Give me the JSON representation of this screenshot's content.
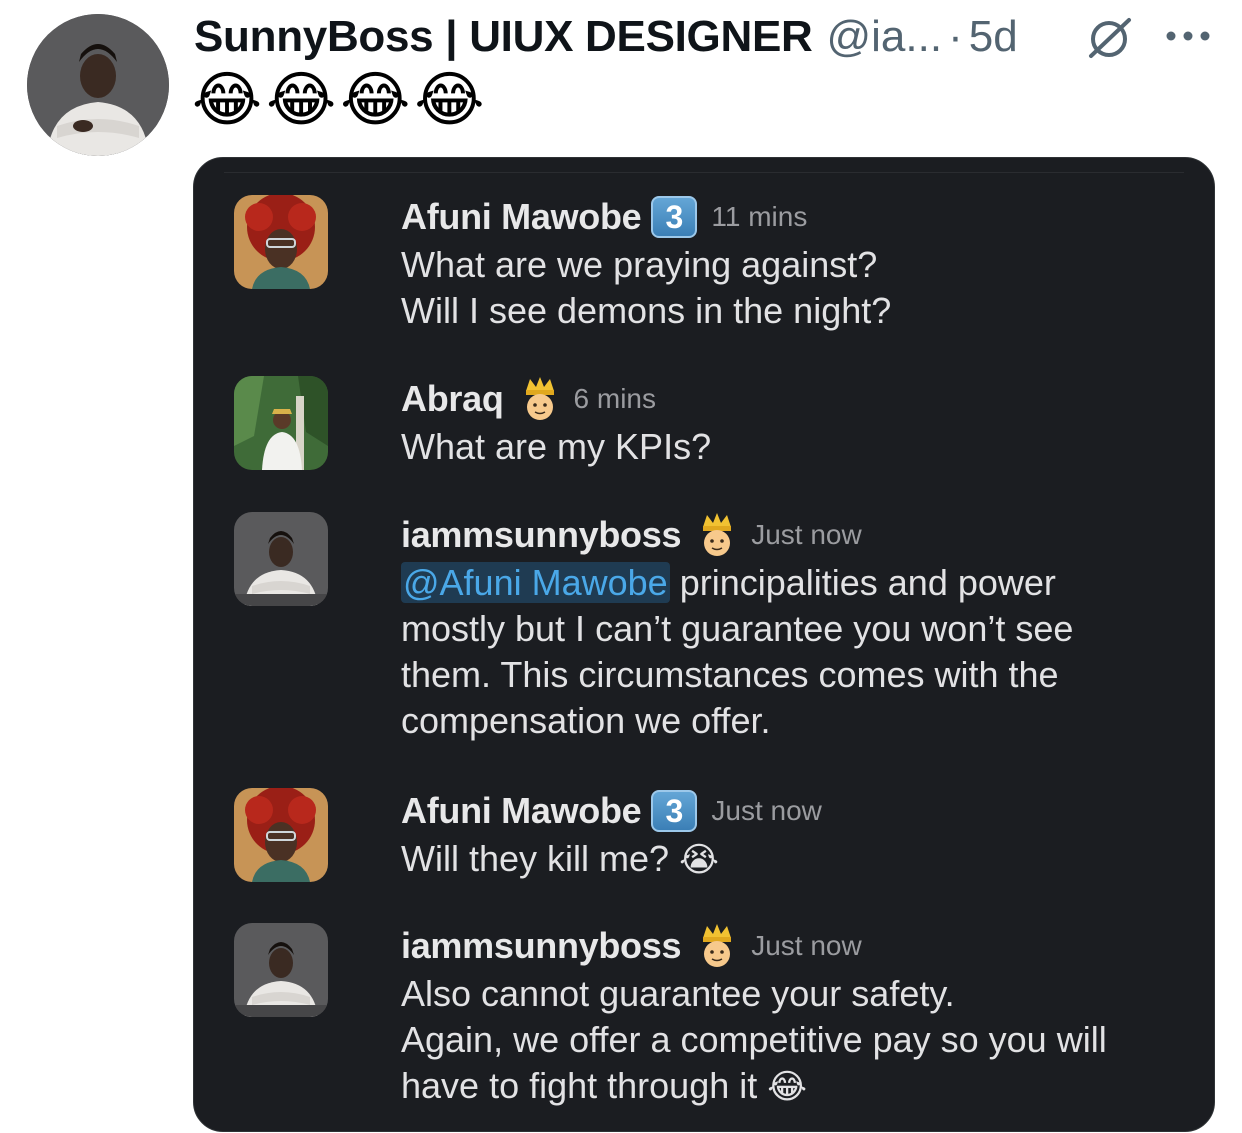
{
  "tweet": {
    "display_name": "SunnyBoss | UIUX DESIGNER",
    "handle": "@ia...",
    "separator": "·",
    "age": "5d",
    "text_emojis": [
      "😂",
      "😂",
      "😂",
      "😂"
    ]
  },
  "chat": {
    "messages": [
      {
        "name": "Afuni Mawobe",
        "badge": "3",
        "time": "11 mins",
        "lines": [
          "What are we praying against?",
          "Will I see demons in the night?"
        ]
      },
      {
        "name": "Abraq",
        "crown_icon": "crown-person-emoji",
        "time": "6 mins",
        "lines": [
          "What are my KPIs?"
        ]
      },
      {
        "name": "iammsunnyboss",
        "crown_icon": "crown-person-emoji",
        "time": "Just now",
        "mention": "@Afuni Mawobe",
        "first_line_rest": " principalities and power",
        "lines": [
          "mostly but I can’t guarantee you won’t see",
          "them. This circumstances comes with the",
          "compensation we offer."
        ]
      },
      {
        "name": "Afuni Mawobe",
        "badge": "3",
        "time": "Just now",
        "text": "Will they kill me?",
        "emoji": "😭"
      },
      {
        "name": "iammsunnyboss",
        "crown_icon": "crown-person-emoji",
        "time": "Just now",
        "lines": [
          "Also cannot guarantee your safety.",
          "Again, we offer a competitive pay so you will"
        ],
        "last_line": "have to fight through it",
        "emoji": "😂"
      }
    ]
  },
  "colors": {
    "chat_bg": "#1b1d21",
    "mention_text": "#4aa8e8",
    "muted": "#536471"
  }
}
